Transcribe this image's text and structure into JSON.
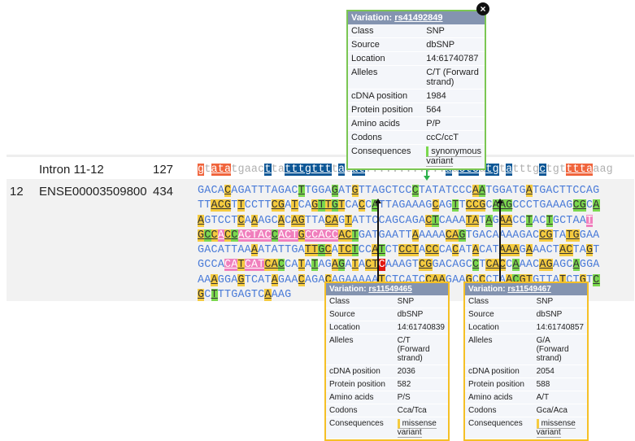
{
  "intron_row": {
    "number": "",
    "name": "Intron 11-12",
    "length": "127"
  },
  "exon_row": {
    "number": "12",
    "name": "ENSE00003509800",
    "length": "434"
  },
  "popups": [
    {
      "title_prefix": "Variation: ",
      "variant_id": "rs41492849",
      "fields": [
        {
          "k": "Class",
          "v": "SNP"
        },
        {
          "k": "Source",
          "v": "dbSNP"
        },
        {
          "k": "Location",
          "v": "14:61740787"
        },
        {
          "k": "Alleles",
          "v": "C/T (Forward strand)"
        },
        {
          "k": "cDNA position",
          "v": "1984"
        },
        {
          "k": "Protein position",
          "v": "564"
        },
        {
          "k": "Amino acids",
          "v": "P/P"
        },
        {
          "k": "Codons",
          "v": "ccC/ccT"
        }
      ],
      "consequences_label": "Consequences",
      "consequence": "synonymous variant",
      "close_icon": "×"
    },
    {
      "title_prefix": "Variation: ",
      "variant_id": "rs11549465",
      "fields": [
        {
          "k": "Class",
          "v": "SNP"
        },
        {
          "k": "Source",
          "v": "dbSNP"
        },
        {
          "k": "Location",
          "v": "14:61740839"
        },
        {
          "k": "Alleles",
          "v": "C/T (Forward strand)"
        },
        {
          "k": "cDNA position",
          "v": "2036"
        },
        {
          "k": "Protein position",
          "v": "582"
        },
        {
          "k": "Amino acids",
          "v": "P/S"
        },
        {
          "k": "Codons",
          "v": "Cca/Tca"
        }
      ],
      "consequences_label": "Consequences",
      "consequence": "missense variant"
    },
    {
      "title_prefix": "Variation: ",
      "variant_id": "rs11549467",
      "fields": [
        {
          "k": "Class",
          "v": "SNP"
        },
        {
          "k": "Source",
          "v": "dbSNP"
        },
        {
          "k": "Location",
          "v": "14:61740857"
        },
        {
          "k": "Alleles",
          "v": "G/A (Forward strand)"
        },
        {
          "k": "cDNA position",
          "v": "2054"
        },
        {
          "k": "Protein position",
          "v": "588"
        },
        {
          "k": "Amino acids",
          "v": "A/T"
        },
        {
          "k": "Codons",
          "v": "Gca/Aca"
        }
      ],
      "consequences_label": "Consequences",
      "consequence": "missense variant"
    }
  ],
  "intron_sequence": [
    [
      "o",
      "g"
    ],
    [
      "",
      "t"
    ],
    [
      "o",
      "ata"
    ],
    [
      "",
      "tgaac"
    ],
    [
      "b",
      "t"
    ],
    [
      "",
      "ta"
    ],
    [
      "b",
      "tttgttt"
    ],
    [
      "",
      "t"
    ],
    [
      "b",
      "a"
    ],
    [
      "",
      "t"
    ],
    [
      "b",
      "at"
    ],
    [
      "",
      "........"
    ],
    [
      "",
      "...."
    ],
    [
      "b",
      "a"
    ],
    [
      "",
      "a"
    ],
    [
      "b",
      "ctc"
    ],
    [
      "",
      "a"
    ],
    [
      "b",
      "tg"
    ],
    [
      "",
      "t"
    ],
    [
      "b",
      "a"
    ],
    [
      "",
      "tttg"
    ],
    [
      "b",
      "c"
    ],
    [
      "",
      "tgt"
    ],
    [
      "o",
      "ttta"
    ],
    [
      "",
      "aag"
    ]
  ],
  "exon_sequence": [
    [
      [
        "",
        "GACA"
      ],
      [
        "y",
        "C"
      ],
      [
        "",
        "AGATTTAGAC"
      ],
      [
        "g",
        "T"
      ],
      [
        "",
        "TGGA"
      ],
      [
        "g",
        "G"
      ],
      [
        "",
        "AT"
      ],
      [
        "y",
        "G"
      ],
      [
        "",
        "TTAGCTCC"
      ],
      [
        "g",
        "C"
      ],
      [
        "",
        "TATATCCC"
      ],
      [
        "y",
        "A"
      ],
      [
        "g",
        "A"
      ],
      [
        "",
        "TGGATG"
      ],
      [
        "y",
        "A"
      ],
      [
        "",
        "TGACTTCCAG"
      ]
    ],
    [
      [
        "",
        "TT"
      ],
      [
        "y",
        "ACG"
      ],
      [
        "",
        "T"
      ],
      [
        "y",
        "T"
      ],
      [
        "",
        "CCTT"
      ],
      [
        "y",
        "CG"
      ],
      [
        "",
        "A"
      ],
      [
        "y",
        "T"
      ],
      [
        "",
        "CA"
      ],
      [
        "y",
        "G"
      ],
      [
        "g",
        "T"
      ],
      [
        "y",
        "T"
      ],
      [
        "g",
        "G"
      ],
      [
        "y",
        "T"
      ],
      [
        "",
        "CA"
      ],
      [
        "y",
        "C"
      ],
      [
        "",
        "C"
      ],
      [
        "g",
        "A"
      ],
      [
        "",
        "TTAGAAAG"
      ],
      [
        "y",
        "C"
      ],
      [
        "",
        "AG"
      ],
      [
        "g",
        "T"
      ],
      [
        "",
        "T"
      ],
      [
        "y",
        "CCG"
      ],
      [
        "",
        "C"
      ],
      [
        "g",
        "AAG"
      ],
      [
        "",
        "CCCTGAAAG"
      ],
      [
        "g",
        "CG"
      ],
      [
        "",
        "C"
      ],
      [
        "g",
        "A"
      ]
    ],
    [
      [
        "y",
        "A"
      ],
      [
        "",
        "GTCCT"
      ],
      [
        "y",
        "C"
      ],
      [
        "",
        "A"
      ],
      [
        "y",
        "A"
      ],
      [
        "",
        "AGC"
      ],
      [
        "y",
        "A"
      ],
      [
        "",
        "C"
      ],
      [
        "y",
        "AG"
      ],
      [
        "",
        "TTA"
      ],
      [
        "y",
        "CA"
      ],
      [
        "",
        "G"
      ],
      [
        "y",
        "T"
      ],
      [
        "",
        "ATTCCAGCAGA"
      ],
      [
        "y",
        "C"
      ],
      [
        "g",
        "T"
      ],
      [
        "",
        "CAAA"
      ],
      [
        "y",
        "TA"
      ],
      [
        "",
        "T"
      ],
      [
        "g",
        "A"
      ],
      [
        "",
        "G"
      ],
      [
        "y",
        "AA"
      ],
      [
        "",
        "CC"
      ],
      [
        "g",
        "T"
      ],
      [
        "",
        "AC"
      ],
      [
        "g",
        "T"
      ],
      [
        "",
        "GCTAA"
      ],
      [
        "p",
        "T"
      ]
    ],
    [
      [
        "y",
        "G"
      ],
      [
        "g",
        "C"
      ],
      [
        "y",
        "C"
      ],
      [
        "p",
        "A"
      ],
      [
        "y",
        "C"
      ],
      [
        "g",
        "C"
      ],
      [
        "p",
        "ACTAC"
      ],
      [
        "g",
        "C"
      ],
      [
        "p",
        "ACT"
      ],
      [
        "y",
        "G"
      ],
      [
        "p",
        "CCACC"
      ],
      [
        "y",
        "AC"
      ],
      [
        "g",
        "T"
      ],
      [
        "",
        "GATGAATT"
      ],
      [
        "y",
        "A"
      ],
      [
        "",
        "AAAA"
      ],
      [
        "y",
        "CA"
      ],
      [
        "g",
        "G"
      ],
      [
        "",
        "TGACAAAAGAC"
      ],
      [
        "y",
        "CG"
      ],
      [
        "",
        "TA"
      ],
      [
        "y",
        "TG"
      ],
      [
        "",
        "GAA"
      ]
    ],
    [
      [
        "",
        "GACATTAA"
      ],
      [
        "y",
        "A"
      ],
      [
        "",
        "ATATTGA"
      ],
      [
        "y",
        "TT"
      ],
      [
        "g",
        "G"
      ],
      [
        "y",
        "C"
      ],
      [
        "",
        "A"
      ],
      [
        "y",
        "TC"
      ],
      [
        "g",
        "T"
      ],
      [
        "",
        "CC"
      ],
      [
        "y",
        "A"
      ],
      [
        "g",
        "T"
      ],
      [
        "",
        "CT"
      ],
      [
        "y",
        "CCT"
      ],
      [
        "",
        "A"
      ],
      [
        "y",
        "CC"
      ],
      [
        "",
        "CA"
      ],
      [
        "y",
        "C"
      ],
      [
        "",
        "AT"
      ],
      [
        "y",
        "A"
      ],
      [
        "",
        "CAT"
      ],
      [
        "y",
        "AAA"
      ],
      [
        "",
        "G"
      ],
      [
        "y",
        "A"
      ],
      [
        "",
        "AACT"
      ],
      [
        "y",
        "AC"
      ],
      [
        "",
        "TA"
      ],
      [
        "y",
        "G"
      ],
      [
        "",
        "T"
      ]
    ],
    [
      [
        "",
        "GCCA"
      ],
      [
        "p",
        "CA"
      ],
      [
        "y",
        "T"
      ],
      [
        "p",
        "CAT"
      ],
      [
        "y",
        "CA"
      ],
      [
        "g",
        "C"
      ],
      [
        "",
        "CA"
      ],
      [
        "y",
        "T"
      ],
      [
        "",
        "A"
      ],
      [
        "g",
        "T"
      ],
      [
        "",
        "AG"
      ],
      [
        "y",
        "A"
      ],
      [
        "g",
        "G"
      ],
      [
        "",
        "A"
      ],
      [
        "y",
        "T"
      ],
      [
        "",
        "A"
      ],
      [
        "y",
        "CT"
      ],
      [
        "r",
        "C"
      ],
      [
        "",
        "AAAGT"
      ],
      [
        "y",
        "CG"
      ],
      [
        "",
        "GACAGC"
      ],
      [
        "g",
        "C"
      ],
      [
        "",
        "T"
      ],
      [
        "y",
        "CAC"
      ],
      [
        "",
        "C"
      ],
      [
        "g",
        "A"
      ],
      [
        "",
        "AAC"
      ],
      [
        "y",
        "AG"
      ],
      [
        "",
        "AGC"
      ],
      [
        "g",
        "A"
      ],
      [
        "",
        "GGA"
      ]
    ],
    [
      [
        "",
        "AA"
      ],
      [
        "y",
        "A"
      ],
      [
        "",
        "GGA"
      ],
      [
        "y",
        "G"
      ],
      [
        "",
        "TCAT"
      ],
      [
        "y",
        "A"
      ],
      [
        "",
        "GAA"
      ],
      [
        "y",
        "C"
      ],
      [
        "",
        "AGA"
      ],
      [
        "y",
        "C"
      ],
      [
        "",
        "AGAAAAA"
      ],
      [
        "y",
        "T"
      ],
      [
        "",
        "CTCATC"
      ],
      [
        "y",
        "CAA"
      ],
      [
        "",
        "GAA"
      ],
      [
        "y",
        "G"
      ],
      [
        "",
        "C"
      ],
      [
        "y",
        "C"
      ],
      [
        "",
        "CTA"
      ],
      [
        "y",
        "A"
      ],
      [
        "g",
        "C"
      ],
      [
        "y",
        "GT"
      ],
      [
        "",
        "GTTA"
      ],
      [
        "y",
        "T"
      ],
      [
        "",
        "CT"
      ],
      [
        "y",
        "G"
      ],
      [
        "",
        "T"
      ],
      [
        "g",
        "C"
      ]
    ],
    [
      [
        "y",
        "G"
      ],
      [
        "",
        "C"
      ],
      [
        "g",
        "T"
      ],
      [
        "",
        "TTGAGTC"
      ],
      [
        "y",
        "A"
      ],
      [
        "",
        "AAG"
      ]
    ]
  ]
}
